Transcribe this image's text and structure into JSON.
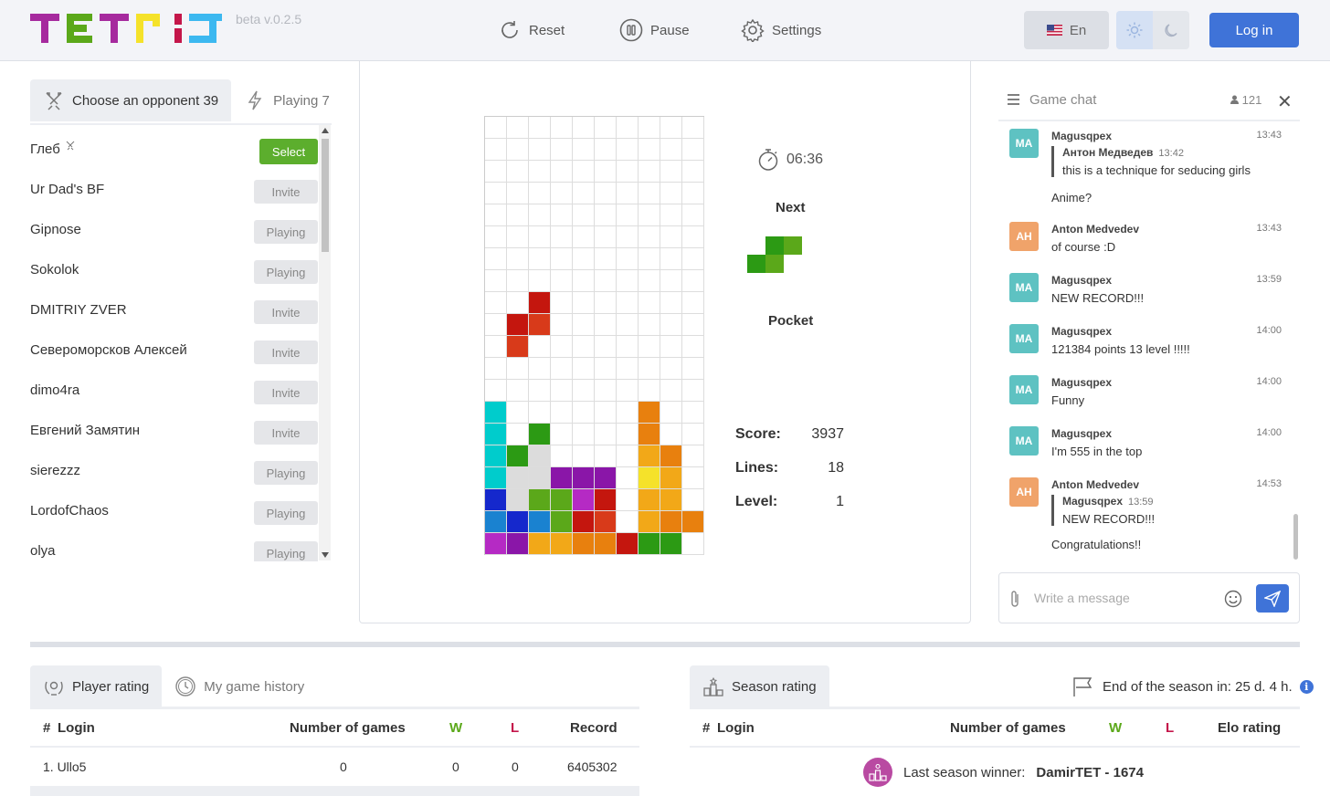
{
  "header": {
    "logo_text": "TETRIS",
    "version": "beta v.0.2.5",
    "reset_label": "Reset",
    "pause_label": "Pause",
    "settings_label": "Settings",
    "language": "En",
    "login_label": "Log in"
  },
  "opponents": {
    "tab_choose": "Choose an opponent 39",
    "tab_playing": "Playing 7",
    "items": [
      {
        "name": "Глеб",
        "action": "Select"
      },
      {
        "name": "Ur Dad's BF",
        "action": "Invite"
      },
      {
        "name": "Gipnose",
        "action": "Playing"
      },
      {
        "name": "Sokolok",
        "action": "Playing"
      },
      {
        "name": "DMITRIY ZVER",
        "action": "Invite"
      },
      {
        "name": "Североморсков Алексей",
        "action": "Invite"
      },
      {
        "name": "dimo4ra",
        "action": "Invite"
      },
      {
        "name": "Евгений Замятин",
        "action": "Invite"
      },
      {
        "name": "sierezzz",
        "action": "Playing"
      },
      {
        "name": "LordofChaos",
        "action": "Playing"
      },
      {
        "name": "olya",
        "action": "Playing"
      }
    ]
  },
  "game": {
    "timer": "06:36",
    "next_label": "Next",
    "pocket_label": "Pocket",
    "score_label": "Score:",
    "score": "3937",
    "lines_label": "Lines:",
    "lines": "18",
    "level_label": "Level:",
    "level": "1",
    "colors": {
      "cyan": "#00cccc",
      "blue": "#1528cc",
      "lblue": "#1a82d0",
      "green": "#2c9a14",
      "lgreen": "#5ba81a",
      "purple": "#8a16a8",
      "magenta": "#b52ac4",
      "red": "#c4160e",
      "ored": "#d83a1a",
      "orange": "#e8800e",
      "amber": "#f2a818",
      "yellow": "#f5e22a",
      "gray": "#dcdcdc"
    },
    "board_rows": [
      "..........",
      "..........",
      "..........",
      "..........",
      "..........",
      "..........",
      "..........",
      "..........",
      "..R.......",
      ".RO.......",
      ".O........",
      "..........",
      "..........",
      "C......O..",
      "C.G....O..",
      "CGG....AO.",
      "CGGPPP.YA.",
      "BNLLMR.AA.",
      "NBNLRO.AOO",
      "MPAAOORGG."
    ],
    "next_piece": "S"
  },
  "chat": {
    "title": "Game chat",
    "online_count": "121",
    "input_placeholder": "Write a message",
    "messages": [
      {
        "avatar": "MA",
        "name": "Magusqpex",
        "time": "13:43",
        "quote": {
          "name": "Антон Медведев",
          "time": "13:42",
          "text": "this is a technique for seducing girls"
        },
        "text": "Anime?"
      },
      {
        "avatar": "AH",
        "name": "Anton Medvedev",
        "time": "13:43",
        "text": "of course :D"
      },
      {
        "avatar": "MA",
        "name": "Magusqpex",
        "time": "13:59",
        "text": "NEW RECORD!!!"
      },
      {
        "avatar": "MA",
        "name": "Magusqpex",
        "time": "14:00",
        "text": "121384 points 13 level !!!!!"
      },
      {
        "avatar": "MA",
        "name": "Magusqpex",
        "time": "14:00",
        "text": "Funny"
      },
      {
        "avatar": "MA",
        "name": "Magusqpex",
        "time": "14:00",
        "text": "I'm 555 in the top"
      },
      {
        "avatar": "AH",
        "name": "Anton Medvedev",
        "time": "14:53",
        "quote": {
          "name": "Magusqpex",
          "time": "13:59",
          "text": "NEW RECORD!!!"
        },
        "text": "Congratulations!!"
      }
    ]
  },
  "ratings": {
    "tab_player_rating": "Player rating",
    "tab_history": "My game history",
    "col_num": "#",
    "col_login": "Login",
    "col_games": "Number of games",
    "col_w": "W",
    "col_l": "L",
    "col_record": "Record",
    "rows": [
      {
        "login": "1. Ullo5",
        "games": "0",
        "w": "0",
        "l": "0",
        "record": "6405302"
      }
    ]
  },
  "season": {
    "tab_label": "Season rating",
    "end_label": "End of the season in: 25 d. 4 h.",
    "col_num": "#",
    "col_login": "Login",
    "col_games": "Number of games",
    "col_w": "W",
    "col_l": "L",
    "col_elo": "Elo rating",
    "winner_label": "Last season winner:",
    "winner_value": "DamirTET - 1674"
  }
}
